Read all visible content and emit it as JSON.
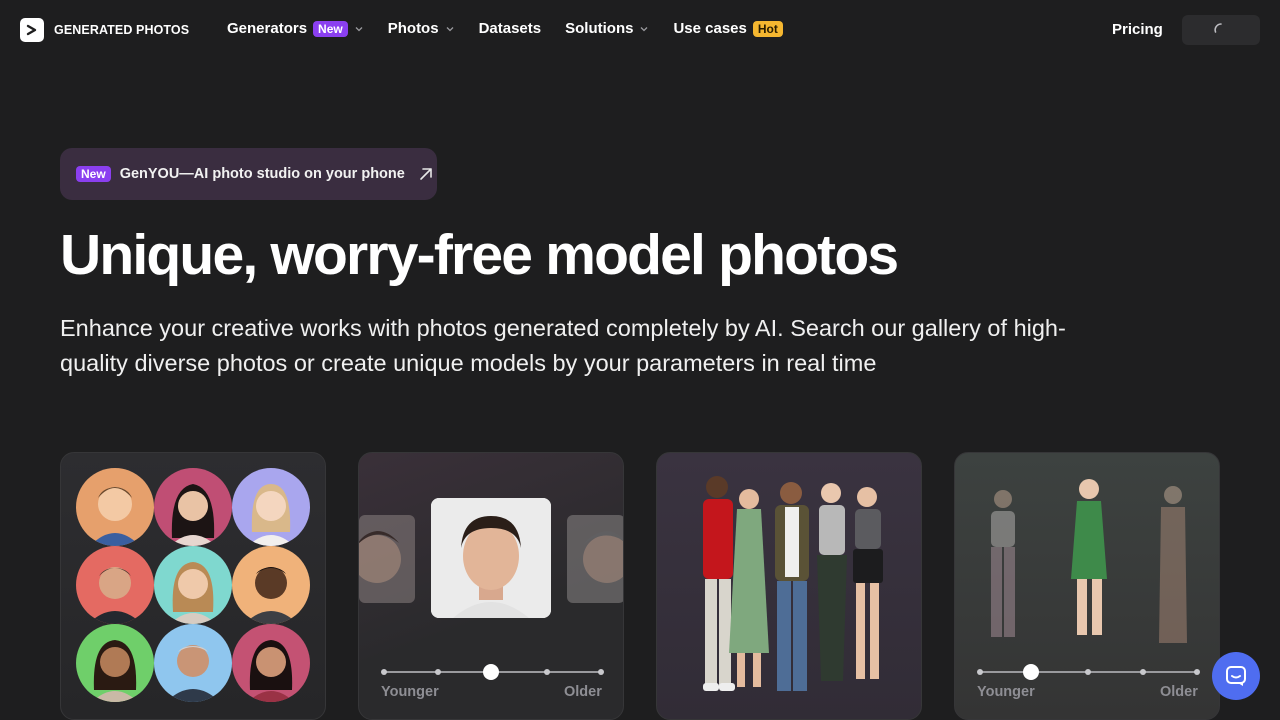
{
  "brand": {
    "name": "GENERATED PHOTOS"
  },
  "nav": {
    "items": [
      {
        "label": "Generators",
        "badge": "New",
        "dropdown": true
      },
      {
        "label": "Photos",
        "dropdown": true
      },
      {
        "label": "Datasets",
        "dropdown": false
      },
      {
        "label": "Solutions",
        "dropdown": true
      },
      {
        "label": "Use cases",
        "badge": "Hot",
        "dropdown": false
      }
    ],
    "pricing": "Pricing"
  },
  "promo": {
    "badge": "New",
    "text": "GenYOU—AI photo studio on your phone"
  },
  "hero": {
    "title": "Unique, worry-free model photos",
    "subtitle": "Enhance your creative works with photos generated completely by AI. Search our gallery of high-quality diverse photos or create unique models by your parameters in real time"
  },
  "cards": {
    "age_slider_faces": {
      "left_label": "Younger",
      "right_label": "Older",
      "position": 0.5
    },
    "age_slider_bodies": {
      "left_label": "Younger",
      "right_label": "Older",
      "position": 0.25
    }
  },
  "colors": {
    "accent": "#8b3ff0",
    "hot": "#f5b730",
    "chat": "#4f6df0",
    "background": "#1e1e1f"
  },
  "icons": {
    "chat": "chat-bubble-icon",
    "arrow": "arrow-up-right-icon",
    "chevron": "chevron-down-icon",
    "spinner": "loading-spinner-icon"
  }
}
